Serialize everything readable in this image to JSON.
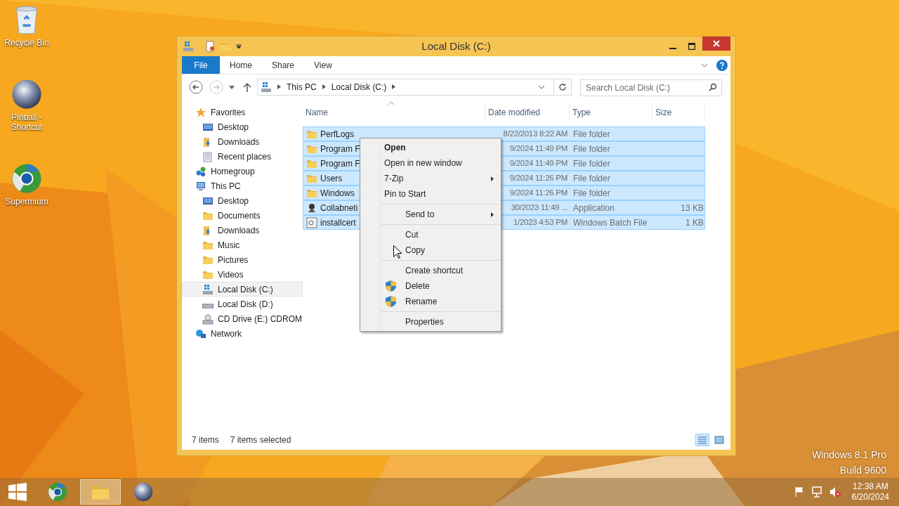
{
  "desktop_icons": [
    {
      "label": "Recycle Bin",
      "kind": "recycle-bin"
    },
    {
      "label": "Pinball - Shortcut",
      "kind": "pinball"
    },
    {
      "label": "Supermium",
      "kind": "browser"
    }
  ],
  "window": {
    "title": "Local Disk (C:)",
    "ribbon_tabs": [
      {
        "label": "File",
        "kind": "file"
      },
      {
        "label": "Home",
        "kind": "tab"
      },
      {
        "label": "Share",
        "kind": "tab"
      },
      {
        "label": "View",
        "kind": "tab"
      }
    ],
    "breadcrumbs": [
      "This PC",
      "Local Disk (C:)"
    ],
    "search": {
      "placeholder": "Search Local Disk (C:)"
    },
    "navigation": [
      {
        "label": "Favorites",
        "kind": "star",
        "selected": false,
        "children": [
          {
            "label": "Desktop",
            "kind": "desktop",
            "selected": false
          },
          {
            "label": "Downloads",
            "kind": "downloads",
            "selected": false
          },
          {
            "label": "Recent places",
            "kind": "recent",
            "selected": false
          }
        ]
      },
      {
        "label": "Homegroup",
        "kind": "homegroup",
        "selected": false
      },
      {
        "label": "This PC",
        "kind": "pc",
        "selected": false,
        "children": [
          {
            "label": "Desktop",
            "kind": "desktop",
            "selected": false
          },
          {
            "label": "Documents",
            "kind": "folder",
            "selected": false
          },
          {
            "label": "Downloads",
            "kind": "downloads",
            "selected": false
          },
          {
            "label": "Music",
            "kind": "folder",
            "selected": false
          },
          {
            "label": "Pictures",
            "kind": "folder",
            "selected": false
          },
          {
            "label": "Videos",
            "kind": "folder",
            "selected": false
          },
          {
            "label": "Local Disk (C:)",
            "kind": "system-drive",
            "selected": true
          },
          {
            "label": "Local Disk (D:)",
            "kind": "drive",
            "selected": false
          },
          {
            "label": "CD Drive (E:) CDROM",
            "kind": "cd",
            "selected": false
          }
        ]
      },
      {
        "label": "Network",
        "kind": "network",
        "selected": false
      }
    ],
    "columns": [
      {
        "label": "Name",
        "sorted": true
      },
      {
        "label": "Date modified",
        "sorted": false
      },
      {
        "label": "Type",
        "sorted": false
      },
      {
        "label": "Size",
        "sorted": false
      }
    ],
    "rows": [
      {
        "name": "PerfLogs",
        "date": "8/22/2013 8:22 AM",
        "type": "File folder",
        "kind": "folder",
        "selected": true
      },
      {
        "name": "Program F",
        "date": "9/2024 11:49 PM",
        "type": "File folder",
        "kind": "folder",
        "selected": true
      },
      {
        "name": "Program F",
        "date": "9/2024 11:49 PM",
        "type": "File folder",
        "kind": "folder",
        "selected": true
      },
      {
        "name": "Users",
        "date": "9/2024 11:26 PM",
        "type": "File folder",
        "kind": "folder",
        "selected": true
      },
      {
        "name": "Windows",
        "date": "9/2024 11:26 PM",
        "type": "File folder",
        "kind": "folder",
        "selected": true
      },
      {
        "name": "Collabneti",
        "date": "30/2023 11:49 ...",
        "type": "Application",
        "size": "13 KB",
        "kind": "application",
        "selected": true
      },
      {
        "name": "installcert",
        "date": "1/2023 4:53 PM",
        "type": "Windows Batch File",
        "size": "1 KB",
        "kind": "batch",
        "selected": true
      }
    ],
    "status_bar": {
      "item_count": "7 items",
      "selection": "7 items selected"
    },
    "view_buttons": [
      {
        "kind": "details",
        "selected": true
      },
      {
        "kind": "tiles",
        "selected": false
      }
    ]
  },
  "context_menu": [
    [
      {
        "label": "Open",
        "default": true,
        "submenu": false,
        "shield": false
      },
      {
        "label": "Open in new window",
        "default": false,
        "submenu": false,
        "shield": false
      },
      {
        "label": "7-Zip",
        "default": false,
        "submenu": true,
        "shield": false
      },
      {
        "label": "Pin to Start",
        "default": false,
        "submenu": false,
        "shield": false
      }
    ],
    [
      {
        "label": "Send to",
        "default": false,
        "submenu": true,
        "shield": false
      }
    ],
    [
      {
        "label": "Cut",
        "default": false,
        "submenu": false,
        "shield": false
      },
      {
        "label": "Copy",
        "default": false,
        "submenu": false,
        "shield": false
      }
    ],
    [
      {
        "label": "Create shortcut",
        "default": false,
        "submenu": false,
        "shield": false
      },
      {
        "label": "Delete",
        "default": false,
        "submenu": false,
        "shield": true
      },
      {
        "label": "Rename",
        "default": false,
        "submenu": false,
        "shield": true
      }
    ],
    [
      {
        "label": "Properties",
        "default": false,
        "submenu": false,
        "shield": false
      }
    ]
  ],
  "watermark": [
    "Windows 8.1 Pro",
    "Build 9600"
  ],
  "taskbar": {
    "apps": [
      {
        "kind": "browser",
        "active": false
      },
      {
        "kind": "explorer",
        "active": true
      },
      {
        "kind": "pinball",
        "active": false
      }
    ],
    "time": "12:38 AM",
    "date": "6/20/2024"
  }
}
